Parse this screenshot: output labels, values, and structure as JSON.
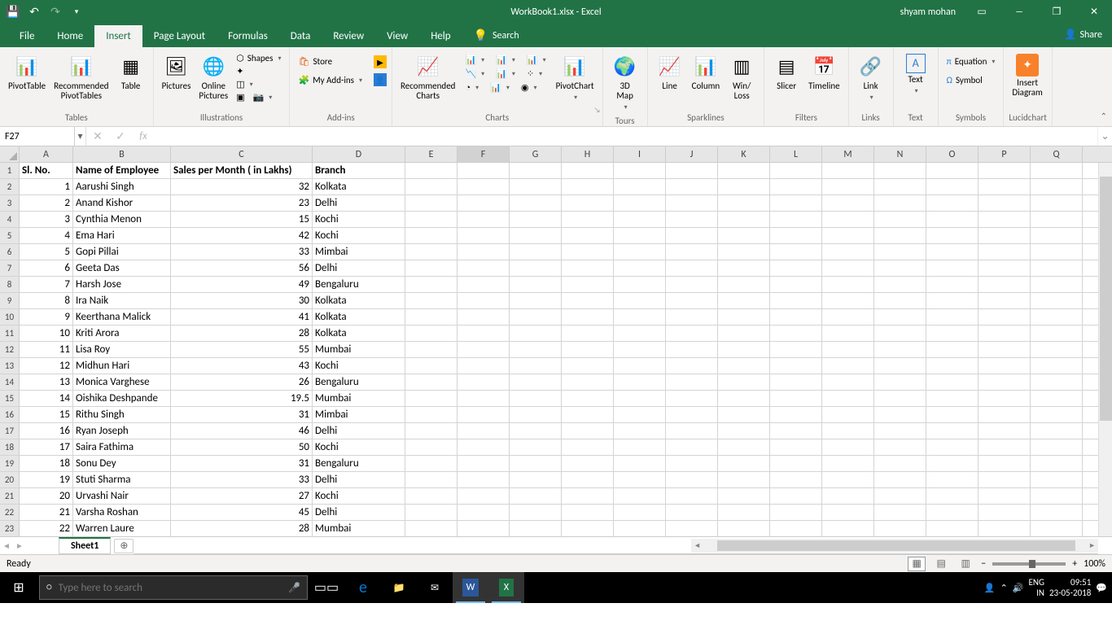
{
  "titlebar": {
    "filename": "WorkBook1.xlsx - Excel",
    "user": "shyam mohan"
  },
  "tabs": [
    "File",
    "Home",
    "Insert",
    "Page Layout",
    "Formulas",
    "Data",
    "Review",
    "View",
    "Help"
  ],
  "activeTab": "Insert",
  "search": "Search",
  "share": "Share",
  "ribbon": {
    "groups": {
      "tables": {
        "label": "Tables",
        "items": [
          "PivotTable",
          "Recommended\nPivotTables",
          "Table"
        ]
      },
      "illustrations": {
        "label": "Illustrations",
        "items": [
          "Pictures",
          "Online\nPictures"
        ],
        "shapes": "Shapes"
      },
      "addins": {
        "label": "Add-ins",
        "store": "Store",
        "myaddins": "My Add-ins"
      },
      "charts": {
        "label": "Charts",
        "recommended": "Recommended\nCharts",
        "pivotchart": "PivotChart"
      },
      "tours": {
        "label": "Tours",
        "map": "3D\nMap"
      },
      "sparklines": {
        "label": "Sparklines",
        "items": [
          "Line",
          "Column",
          "Win/\nLoss"
        ]
      },
      "filters": {
        "label": "Filters",
        "items": [
          "Slicer",
          "Timeline"
        ]
      },
      "links": {
        "label": "Links",
        "link": "Link"
      },
      "text": {
        "label": "Text",
        "text": "Text"
      },
      "symbols": {
        "label": "Symbols",
        "equation": "Equation",
        "symbol": "Symbol"
      },
      "lucid": {
        "label": "Lucidchart",
        "item": "Insert\nDiagram"
      }
    }
  },
  "namebox": "F27",
  "formula": "",
  "columns": [
    {
      "l": "A",
      "w": 66
    },
    {
      "l": "B",
      "w": 120
    },
    {
      "l": "C",
      "w": 174
    },
    {
      "l": "D",
      "w": 114
    },
    {
      "l": "E",
      "w": 64
    },
    {
      "l": "F",
      "w": 64
    },
    {
      "l": "G",
      "w": 64
    },
    {
      "l": "H",
      "w": 64
    },
    {
      "l": "I",
      "w": 64
    },
    {
      "l": "J",
      "w": 64
    },
    {
      "l": "K",
      "w": 64
    },
    {
      "l": "L",
      "w": 64
    },
    {
      "l": "M",
      "w": 64
    },
    {
      "l": "N",
      "w": 64
    },
    {
      "l": "O",
      "w": 64
    },
    {
      "l": "P",
      "w": 64
    },
    {
      "l": "Q",
      "w": 64
    }
  ],
  "activeCol": 5,
  "headers": [
    "Sl. No.",
    "Name of Employee",
    "Sales per Month ( in Lakhs)",
    "Branch"
  ],
  "rows": [
    [
      1,
      "Aarushi Singh",
      32,
      "Kolkata"
    ],
    [
      2,
      "Anand Kishor",
      23,
      "Delhi"
    ],
    [
      3,
      "Cynthia Menon",
      15,
      "Kochi"
    ],
    [
      4,
      "Ema Hari",
      42,
      "Kochi"
    ],
    [
      5,
      "Gopi Pillai",
      33,
      "Mimbai"
    ],
    [
      6,
      "Geeta Das",
      56,
      "Delhi"
    ],
    [
      7,
      "Harsh Jose",
      49,
      "Bengaluru"
    ],
    [
      8,
      "Ira Naik",
      30,
      "Kolkata"
    ],
    [
      9,
      "Keerthana Malick",
      41,
      "Kolkata"
    ],
    [
      10,
      "Kriti Arora",
      28,
      "Kolkata"
    ],
    [
      11,
      "Lisa Roy",
      55,
      "Mumbai"
    ],
    [
      12,
      "Midhun Hari",
      43,
      "Kochi"
    ],
    [
      13,
      "Monica Varghese",
      26,
      "Bengaluru"
    ],
    [
      14,
      "Oishika Deshpande",
      19.5,
      "Mumbai"
    ],
    [
      15,
      "Rithu Singh",
      31,
      "Mimbai"
    ],
    [
      16,
      "Ryan Joseph",
      46,
      "Delhi"
    ],
    [
      17,
      "Saira Fathima",
      50,
      "Kochi"
    ],
    [
      18,
      "Sonu Dey",
      31,
      "Bengaluru"
    ],
    [
      19,
      "Stuti Sharma",
      33,
      "Delhi"
    ],
    [
      20,
      "Urvashi Nair",
      27,
      "Kochi"
    ],
    [
      21,
      "Varsha Roshan",
      45,
      "Delhi"
    ],
    [
      22,
      "Warren Laure",
      28,
      "Mumbai"
    ]
  ],
  "sheet": "Sheet1",
  "status": "Ready",
  "zoom": "100%",
  "taskbar": {
    "search": "Type here to search",
    "lang1": "ENG",
    "lang2": "IN",
    "time": "09:51",
    "date": "23-05-2018"
  }
}
